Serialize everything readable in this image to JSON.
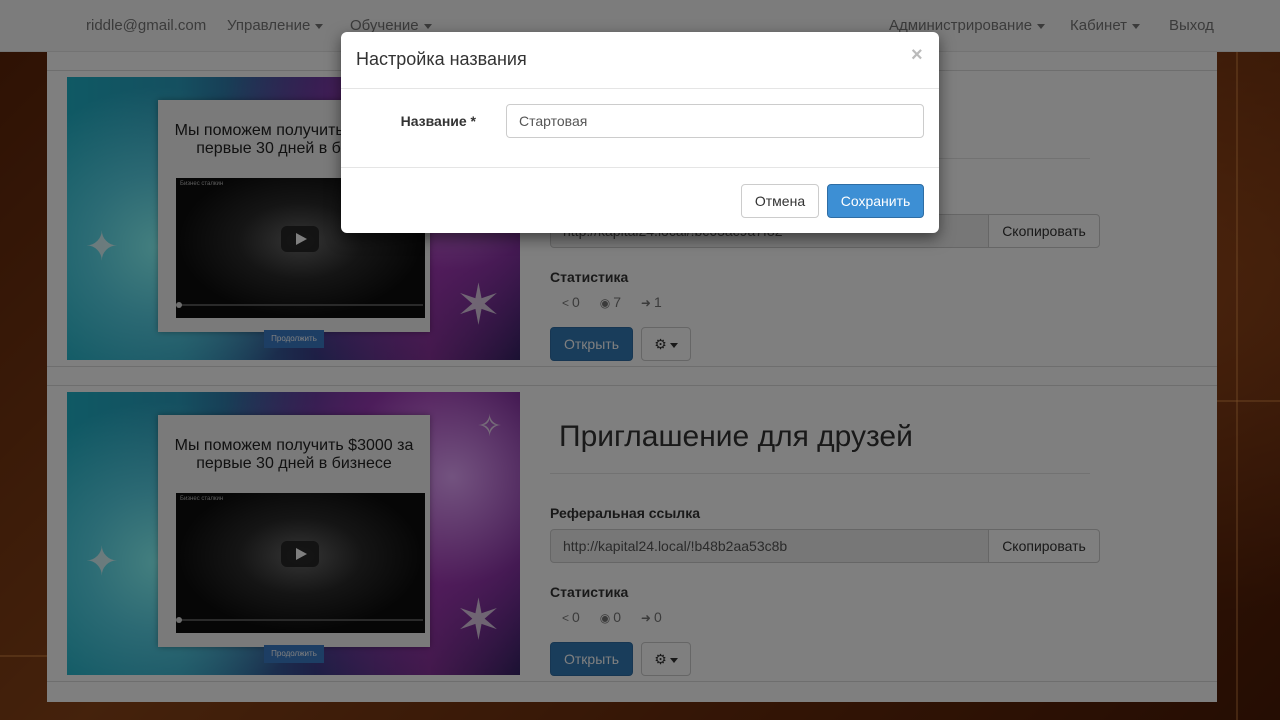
{
  "navbar": {
    "user_email": "riddle@gmail.com",
    "menu_manage": "Управление",
    "menu_learning": "Обучение",
    "menu_admin": "Администрирование",
    "menu_cabinet": "Кабинет",
    "logout": "Выход"
  },
  "cards": [
    {
      "thumbnail": {
        "headline": "Мы поможем получить $3000 за первые 30 дней в бизнесе",
        "video_title": "Бизнес сталкин",
        "continue_label": "Продолжить"
      },
      "title": "",
      "referral_label": "",
      "referral_link": "http://kapital24.local/!bc63ac9a7f82",
      "copy_label": "Скопировать",
      "stats_label": "Статистика",
      "stats": {
        "shares": "0",
        "views": "7",
        "signups": "1"
      },
      "open_label": "Открыть"
    },
    {
      "thumbnail": {
        "headline": "Мы поможем получить $3000 за первые 30 дней в бизнесе",
        "video_title": "Бизнес сталкин",
        "continue_label": "Продолжить"
      },
      "title": "Приглашение для друзей",
      "referral_label": "Реферальная ссылка",
      "referral_link": "http://kapital24.local/!b48b2aa53c8b",
      "copy_label": "Скопировать",
      "stats_label": "Статистика",
      "stats": {
        "shares": "0",
        "views": "0",
        "signups": "0"
      },
      "open_label": "Открыть"
    }
  ],
  "modal": {
    "title": "Настройка названия",
    "close": "×",
    "field_label": "Название *",
    "field_value": "Стартовая",
    "cancel_label": "Отмена",
    "save_label": "Сохранить"
  },
  "icons": {
    "share": "share-icon",
    "views": "eye-icon",
    "signups": "sign-in-icon",
    "settings": "gear-icon"
  },
  "colors": {
    "primary": "#337ab7",
    "save": "#3d8fd4",
    "navbar_bg": "#f8f8f8"
  }
}
